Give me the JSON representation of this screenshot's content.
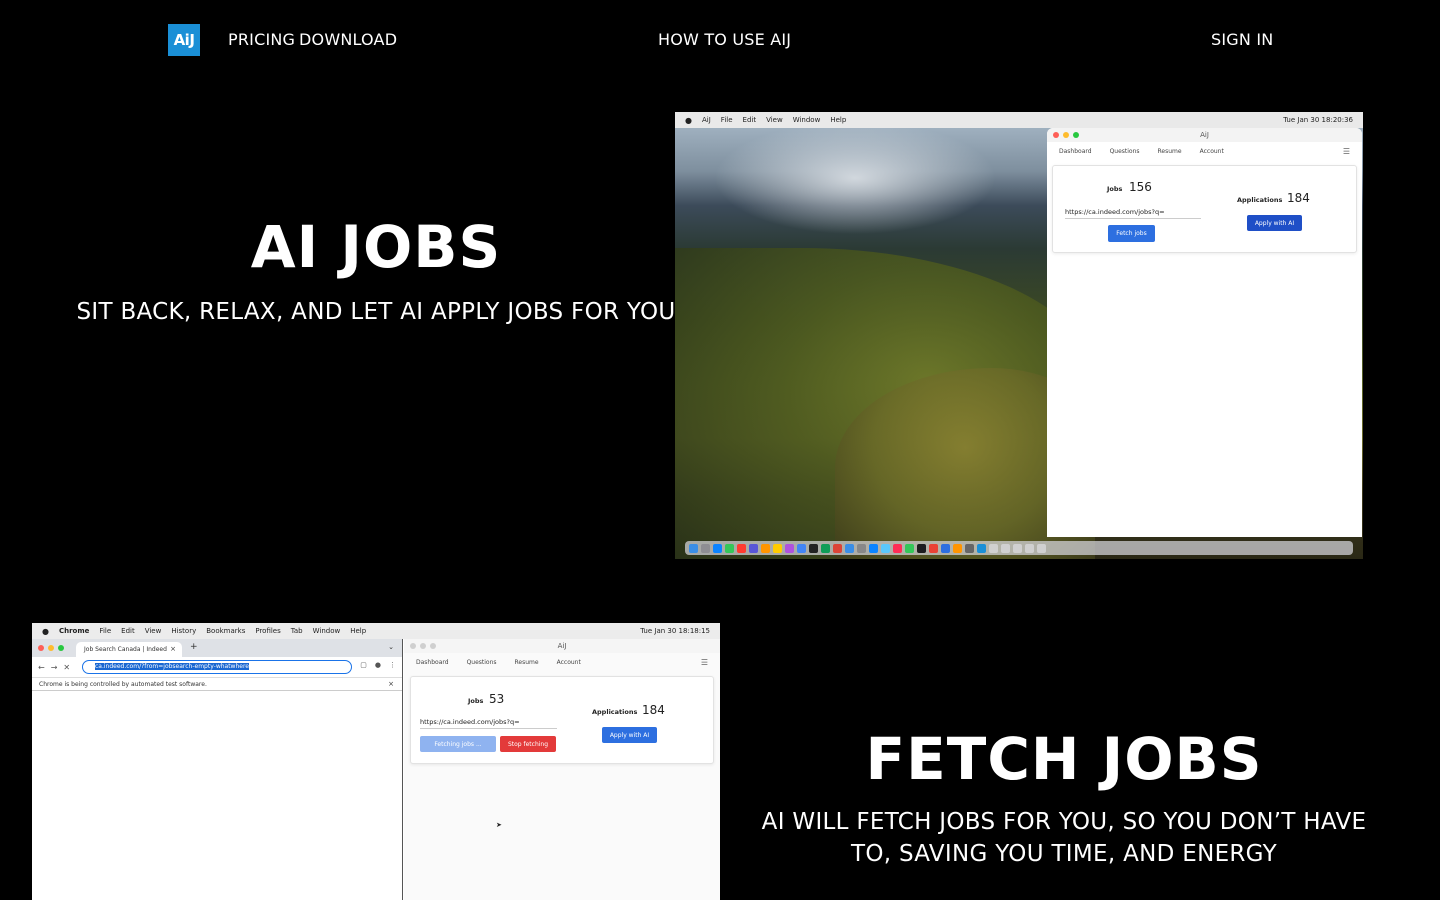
{
  "nav": {
    "logo": "AiJ",
    "pricing": "PRICING",
    "download": "DOWNLOAD",
    "how_to": "HOW TO USE AIJ",
    "sign_in": "SIGN IN"
  },
  "hero1": {
    "title": "AI JOBS",
    "subtitle": "SIT BACK, RELAX, AND LET AI APPLY JOBS FOR YOU"
  },
  "hero2": {
    "title": "FETCH JOBS",
    "subtitle": "AI WILL FETCH JOBS FOR YOU, SO YOU DON’T HAVE TO, SAVING YOU TIME, AND ENERGY"
  },
  "shot1": {
    "menubar": [
      "AiJ",
      "File",
      "Edit",
      "View",
      "Window",
      "Help"
    ],
    "clock": "Tue Jan 30  18:20:36",
    "app": {
      "title": "AiJ",
      "tabs": [
        "Dashboard",
        "Questions",
        "Resume",
        "Account"
      ],
      "jobs_label": "Jobs",
      "jobs_count": "156",
      "url": "https://ca.indeed.com/jobs?q=",
      "fetch_button": "Fetch jobs",
      "applications_label": "Applications",
      "applications_count": "184",
      "apply_button": "Apply with AI"
    }
  },
  "shot2": {
    "menubar": [
      "Chrome",
      "File",
      "Edit",
      "View",
      "History",
      "Bookmarks",
      "Profiles",
      "Tab",
      "Window",
      "Help"
    ],
    "clock": "Tue Jan 30  18:18:15",
    "chrome": {
      "tab_title": "Job Search Canada | Indeed",
      "url": "ca.indeed.com/?from=jobsearch-empty-whatwhere",
      "infobar": "Chrome is being controlled by automated test software."
    },
    "app": {
      "title": "AiJ",
      "tabs": [
        "Dashboard",
        "Questions",
        "Resume",
        "Account"
      ],
      "jobs_label": "Jobs",
      "jobs_count": "53",
      "url": "https://ca.indeed.com/jobs?q=",
      "fetching_button": "Fetching jobs ...",
      "stop_button": "Stop fetching",
      "applications_label": "Applications",
      "applications_count": "184",
      "apply_button": "Apply with AI"
    }
  }
}
